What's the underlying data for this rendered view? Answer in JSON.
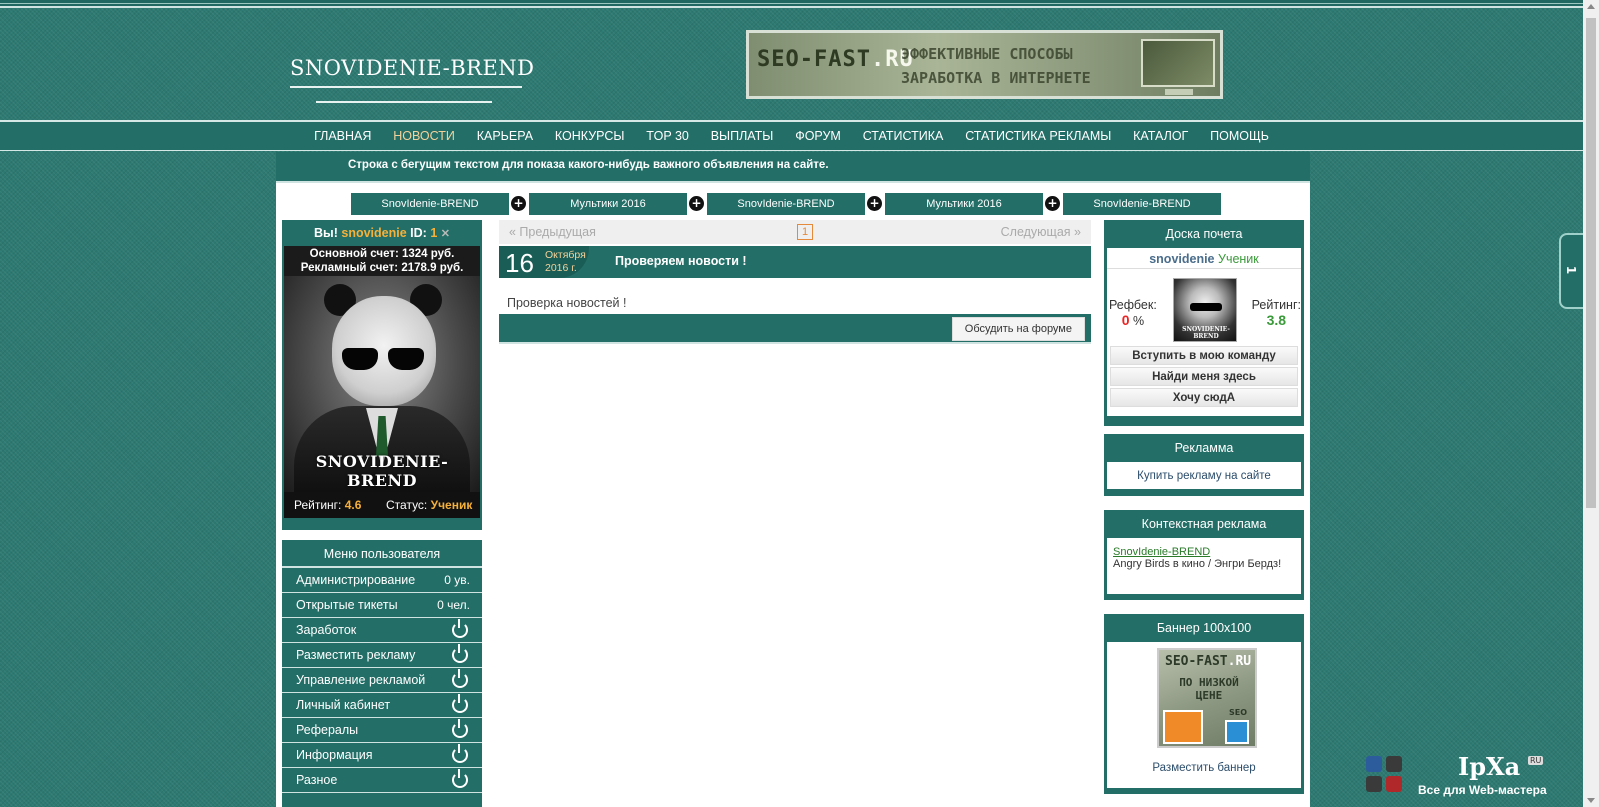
{
  "brand": {
    "logo_text": "SNOVIDENIE-BREND"
  },
  "top_banner": {
    "logo": "SEO-FAST",
    "logo_suffix": ".RU",
    "text": "ЭФФЕКТИВНЫЕ СПОСОБЫ ЗАРАБОТКА В ИНТЕРНЕТЕ"
  },
  "nav": {
    "items": [
      {
        "label": "ГЛАВНАЯ"
      },
      {
        "label": "НОВОСТИ"
      },
      {
        "label": "КАРЬЕРА"
      },
      {
        "label": "КОНКУРСЫ"
      },
      {
        "label": "TOP 30"
      },
      {
        "label": "ВЫПЛАТЫ"
      },
      {
        "label": "ФОРУМ"
      },
      {
        "label": "СТАТИСТИКА"
      },
      {
        "label": "СТАТИСТИКА РЕКЛАМЫ"
      },
      {
        "label": "КАТАЛОГ"
      },
      {
        "label": "ПОМОЩЬ"
      }
    ]
  },
  "ticker": {
    "text": "Строка с бегущим текстом для показа какого-нибудь важного объявления на сайте."
  },
  "tabs": [
    {
      "label": "SnovIdenie-BREND"
    },
    {
      "label": "Мультики 2016"
    },
    {
      "label": "SnovIdenie-BREND"
    },
    {
      "label": "Мультики 2016"
    },
    {
      "label": "SnovIdenie-BREND"
    }
  ],
  "user": {
    "hello": "Вы!",
    "nick": "snovidenie",
    "id_label": "ID:",
    "id": "1",
    "main_balance": "Основной счет: 1324 руб.",
    "ad_balance": "Рекламный счет: 2178.9 руб.",
    "avatar_caption": "SNOVIDENIE-BREND",
    "rating_label": "Рейтинг:",
    "rating": "4.6",
    "status_label": "Статус:",
    "status": "Ученик"
  },
  "user_menu": {
    "title": "Меню пользователя",
    "items": [
      {
        "label": "Администрирование",
        "count": "0 ув."
      },
      {
        "label": "Открытые тикеты",
        "count": "0 чел."
      },
      {
        "label": "Заработок"
      },
      {
        "label": "Разместить рекламу"
      },
      {
        "label": "Управление рекламой"
      },
      {
        "label": "Личный кабинет"
      },
      {
        "label": "Рефералы"
      },
      {
        "label": "Информация"
      },
      {
        "label": "Разное"
      }
    ]
  },
  "pager": {
    "prev": "« Предыдущая",
    "next": "Следующая »",
    "current": "1"
  },
  "news": {
    "day": "16",
    "month": "Октября",
    "year": "2016 г.",
    "title": "Проверяем новости !",
    "body": "Проверка новостей !",
    "discuss_button": "Обсудить на форуме"
  },
  "honor_board": {
    "title": "Доска почета",
    "name": "snovidenie",
    "rank": "Ученик",
    "refback_label": "Рефбек:",
    "refback_value": "0",
    "refback_unit": "%",
    "rating_label": "Рейтинг:",
    "rating_value": "3.8",
    "avatar_caption": "SNOVIDENIE-BREND",
    "buttons": [
      {
        "label": "Вступить в мою команду"
      },
      {
        "label": "Найди меня здесь"
      },
      {
        "label": "Хочу сюдА"
      }
    ]
  },
  "ads": {
    "title": "Рекламма",
    "link": "Купить рекламу на сайте"
  },
  "context_ads": {
    "title": "Контекстная реклама",
    "link": "SnovIdenie-BREND",
    "desc": "Angry Birds в кино / Энгри Бердз!"
  },
  "banner100": {
    "title": "Баннер 100х100",
    "logo": "SEO-FAST",
    "logo_suffix": ".RU",
    "text": "ПО НИЗКОЙ ЦЕНЕ",
    "tag": "SEO",
    "link": "Разместить баннер"
  },
  "side_tab": {
    "label": "1"
  },
  "watermark": {
    "name": "IpXa",
    "ru": "RU",
    "sub": "Все для Web-мастера"
  },
  "colors": {
    "primary": "#236e67",
    "accent_orange": "#f6b13a",
    "accent_active_nav": "#f2d29b",
    "rating_green": "#3a9a3a",
    "refback_red": "#ee2222"
  }
}
